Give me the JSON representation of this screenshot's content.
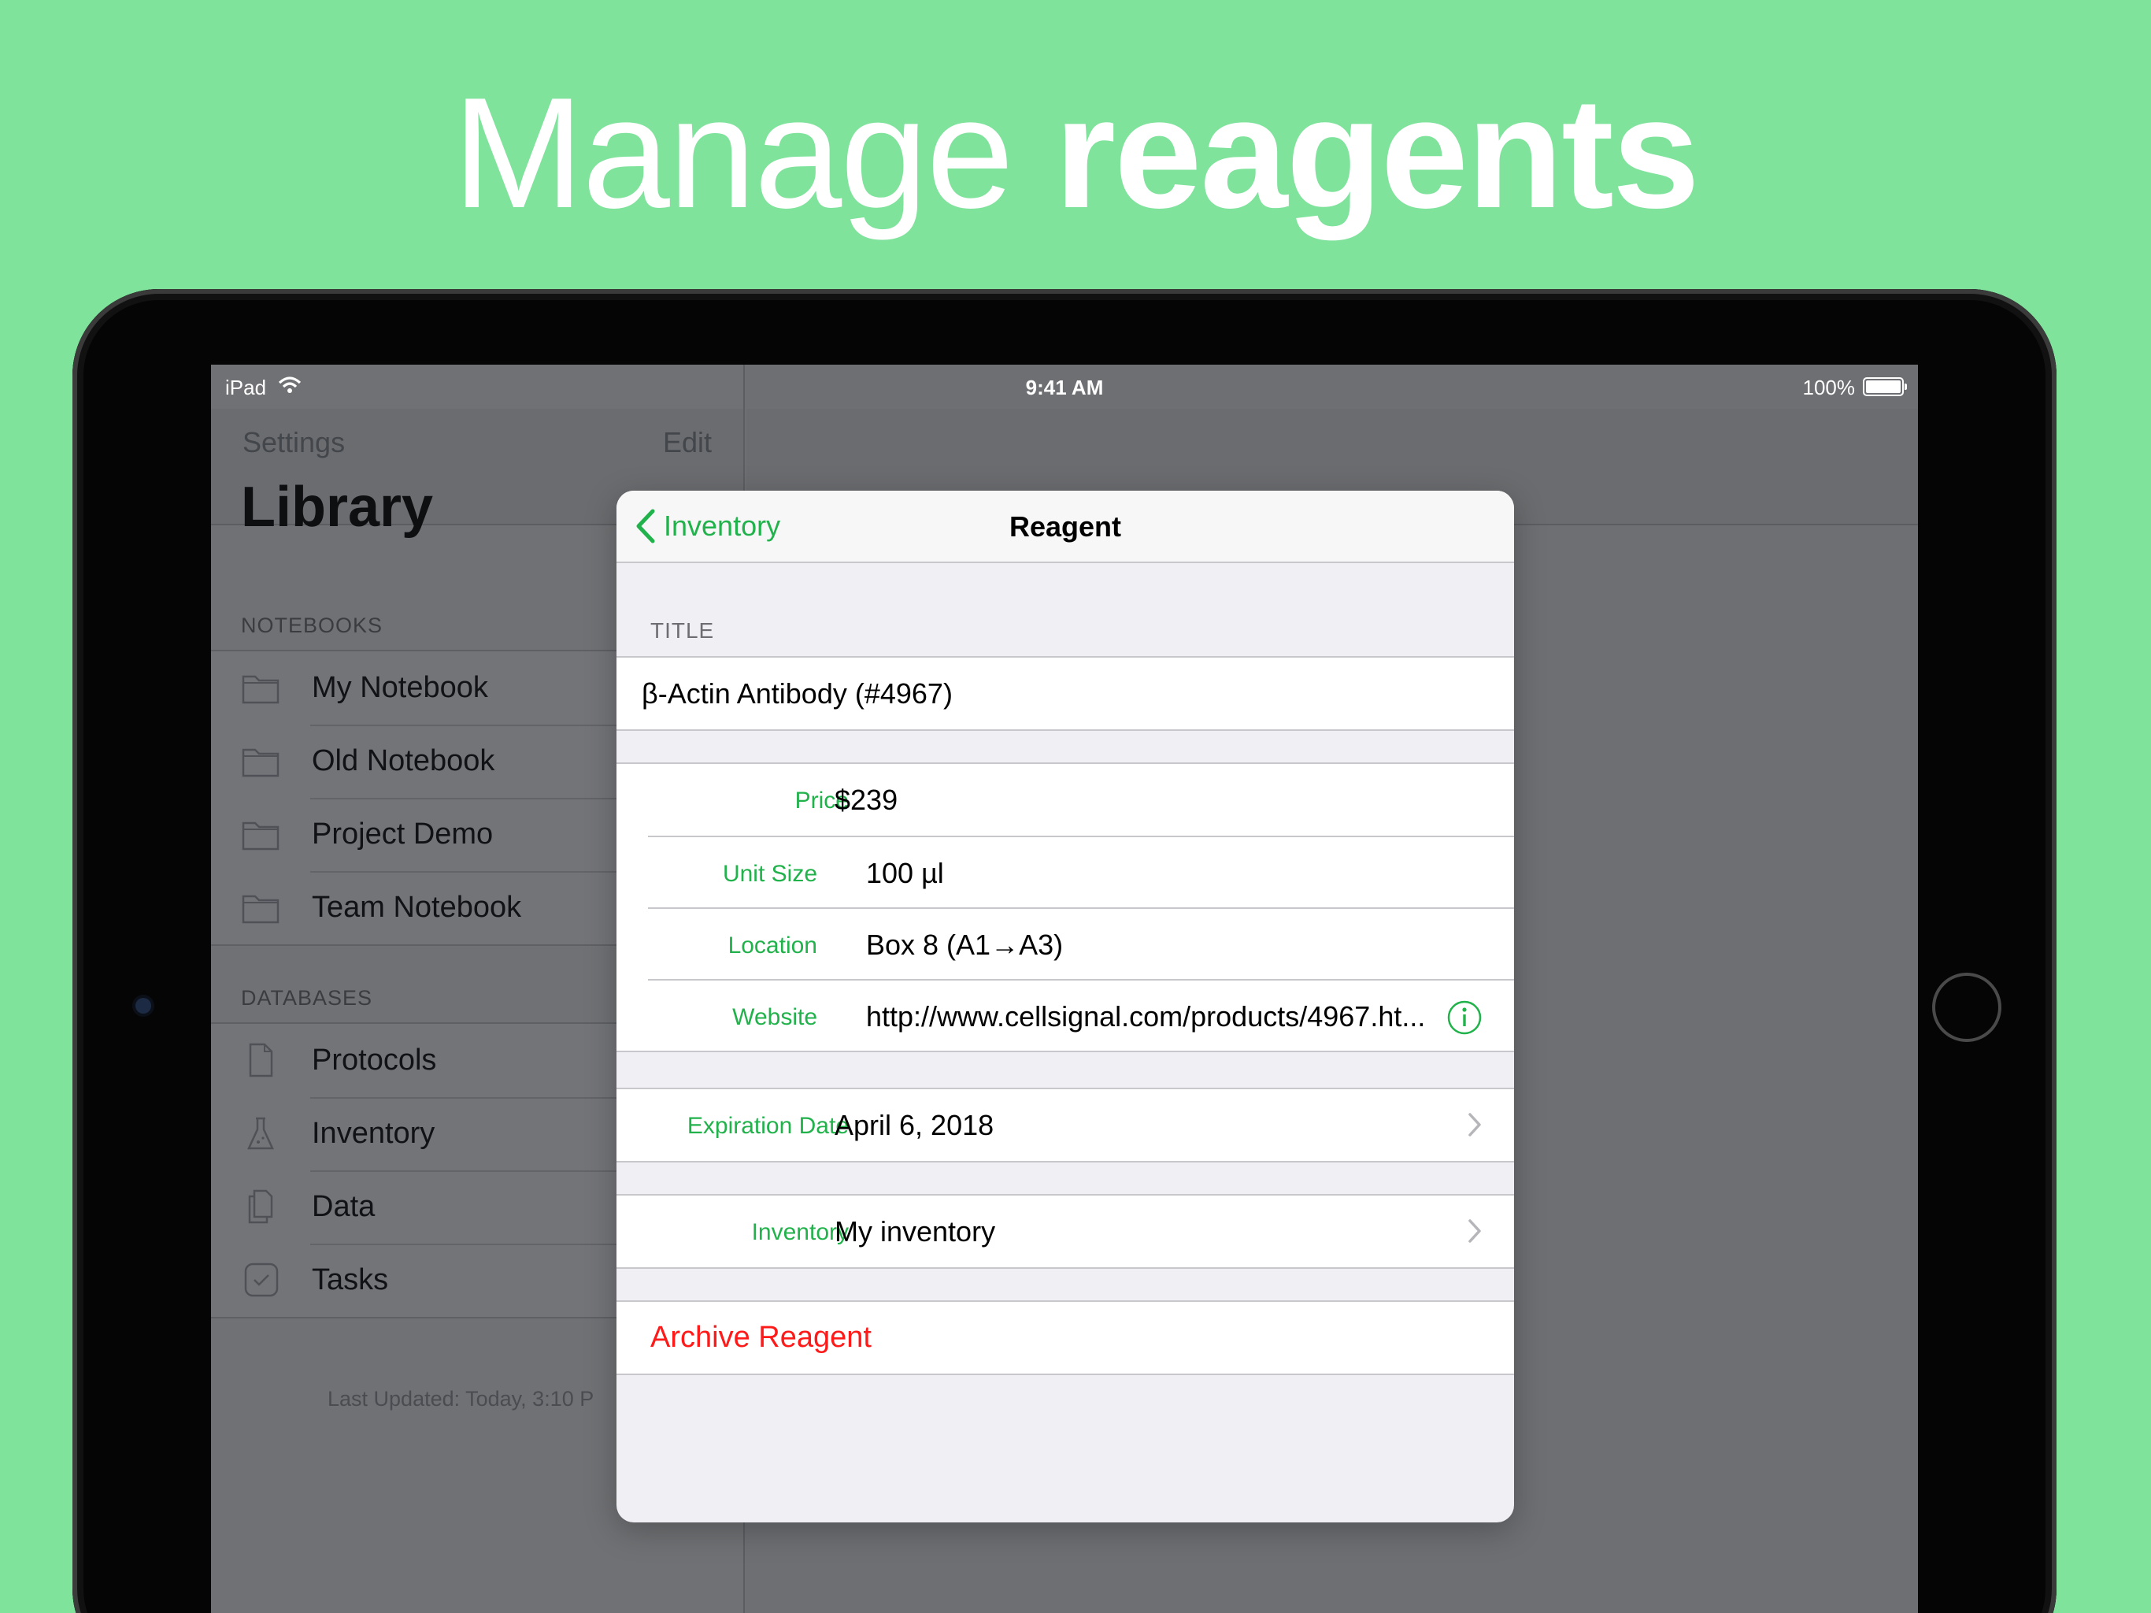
{
  "headline": {
    "light": "Manage",
    "bold": "reagents"
  },
  "status_bar": {
    "carrier": "iPad",
    "time": "9:41 AM",
    "battery": "100%"
  },
  "sidebar": {
    "nav_left": "Settings",
    "nav_right": "Edit",
    "title": "Library",
    "notebooks_header": "NOTEBOOKS",
    "notebooks": [
      {
        "label": "My Notebook",
        "icon": "folder-icon"
      },
      {
        "label": "Old Notebook",
        "icon": "folder-icon"
      },
      {
        "label": "Project Demo",
        "icon": "folder-icon"
      },
      {
        "label": "Team Notebook",
        "icon": "folder-icon"
      }
    ],
    "databases_header": "DATABASES",
    "databases": [
      {
        "label": "Protocols",
        "icon": "document-icon"
      },
      {
        "label": "Inventory",
        "icon": "flask-icon"
      },
      {
        "label": "Data",
        "icon": "files-icon"
      },
      {
        "label": "Tasks",
        "icon": "checkbox-icon"
      }
    ],
    "footer": "Last Updated: Today, 3:10 P"
  },
  "popover": {
    "back_label": "Inventory",
    "title": "Reagent",
    "title_section_label": "TITLE",
    "reagent_title": "β-Actin Antibody (#4967)",
    "fields": [
      {
        "key": "Price",
        "value": "$239"
      },
      {
        "key": "Unit Size",
        "value": "100 µl"
      },
      {
        "key": "Location",
        "value": "Box 8 (A1→A3)"
      },
      {
        "key": "Website",
        "value": "http://www.cellsignal.com/products/4967.ht..."
      }
    ],
    "expiration": {
      "key": "Expiration Date",
      "value": "April 6, 2018"
    },
    "inventory": {
      "key": "Inventory",
      "value": "My inventory"
    },
    "archive_label": "Archive Reagent"
  },
  "colors": {
    "background": "#7fe39c",
    "accent": "#21b24b",
    "destructive": "#ff1a1a"
  }
}
